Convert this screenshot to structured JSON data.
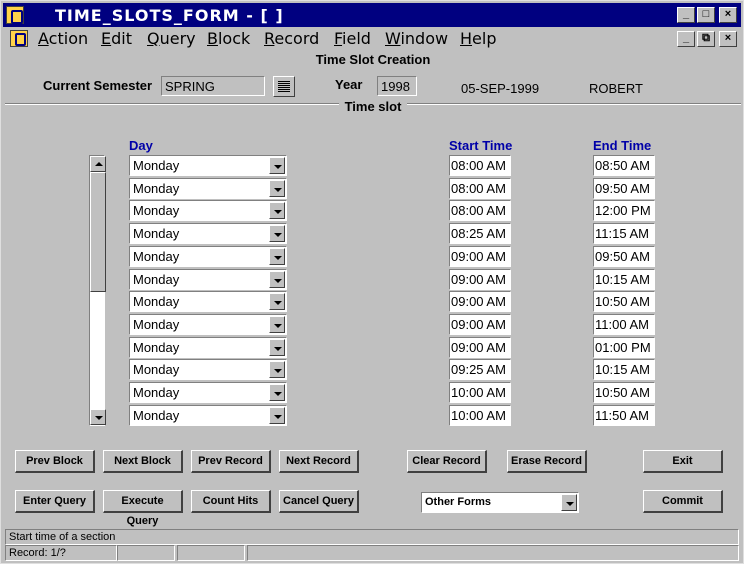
{
  "window": {
    "title": "TIME_SLOTS_FORM - [ ]"
  },
  "menu": [
    "Action",
    "Edit",
    "Query",
    "Block",
    "Record",
    "Field",
    "Window",
    "Help"
  ],
  "menu_accel": [
    "A",
    "E",
    "Q",
    "B",
    "R",
    "F",
    "W",
    "H"
  ],
  "form": {
    "title": "Time Slot Creation",
    "semester_label": "Current Semester",
    "semester_value": "SPRING",
    "year_label": "Year",
    "year_value": "1998",
    "date": "05-SEP-1999",
    "user": "ROBERT"
  },
  "section": {
    "title": "Time slot",
    "col_day": "Day",
    "col_start": "Start Time",
    "col_end": "End Time"
  },
  "rows": [
    {
      "day": "Monday",
      "start": "08:00 AM",
      "end": "08:50 AM"
    },
    {
      "day": "Monday",
      "start": "08:00 AM",
      "end": "09:50 AM"
    },
    {
      "day": "Monday",
      "start": "08:00 AM",
      "end": "12:00 PM"
    },
    {
      "day": "Monday",
      "start": "08:25 AM",
      "end": "11:15 AM"
    },
    {
      "day": "Monday",
      "start": "09:00 AM",
      "end": "09:50 AM"
    },
    {
      "day": "Monday",
      "start": "09:00 AM",
      "end": "10:15 AM"
    },
    {
      "day": "Monday",
      "start": "09:00 AM",
      "end": "10:50 AM"
    },
    {
      "day": "Monday",
      "start": "09:00 AM",
      "end": "11:00 AM"
    },
    {
      "day": "Monday",
      "start": "09:00 AM",
      "end": "01:00 PM"
    },
    {
      "day": "Monday",
      "start": "09:25 AM",
      "end": "10:15 AM"
    },
    {
      "day": "Monday",
      "start": "10:00 AM",
      "end": "10:50 AM"
    },
    {
      "day": "Monday",
      "start": "10:00 AM",
      "end": "11:50 AM"
    }
  ],
  "buttons": {
    "prev_block": "Prev Block",
    "next_block": "Next Block",
    "prev_record": "Prev Record",
    "next_record": "Next Record",
    "clear_record": "Clear Record",
    "erase_record": "Erase Record",
    "exit": "Exit",
    "enter_query": "Enter Query",
    "execute_query": "Execute Query",
    "count_hits": "Count Hits",
    "cancel_query": "Cancel Query",
    "commit": "Commit"
  },
  "other_forms": {
    "selected": "Other Forms"
  },
  "status": {
    "message": "Start time of a section",
    "record": "Record: 1/?"
  }
}
